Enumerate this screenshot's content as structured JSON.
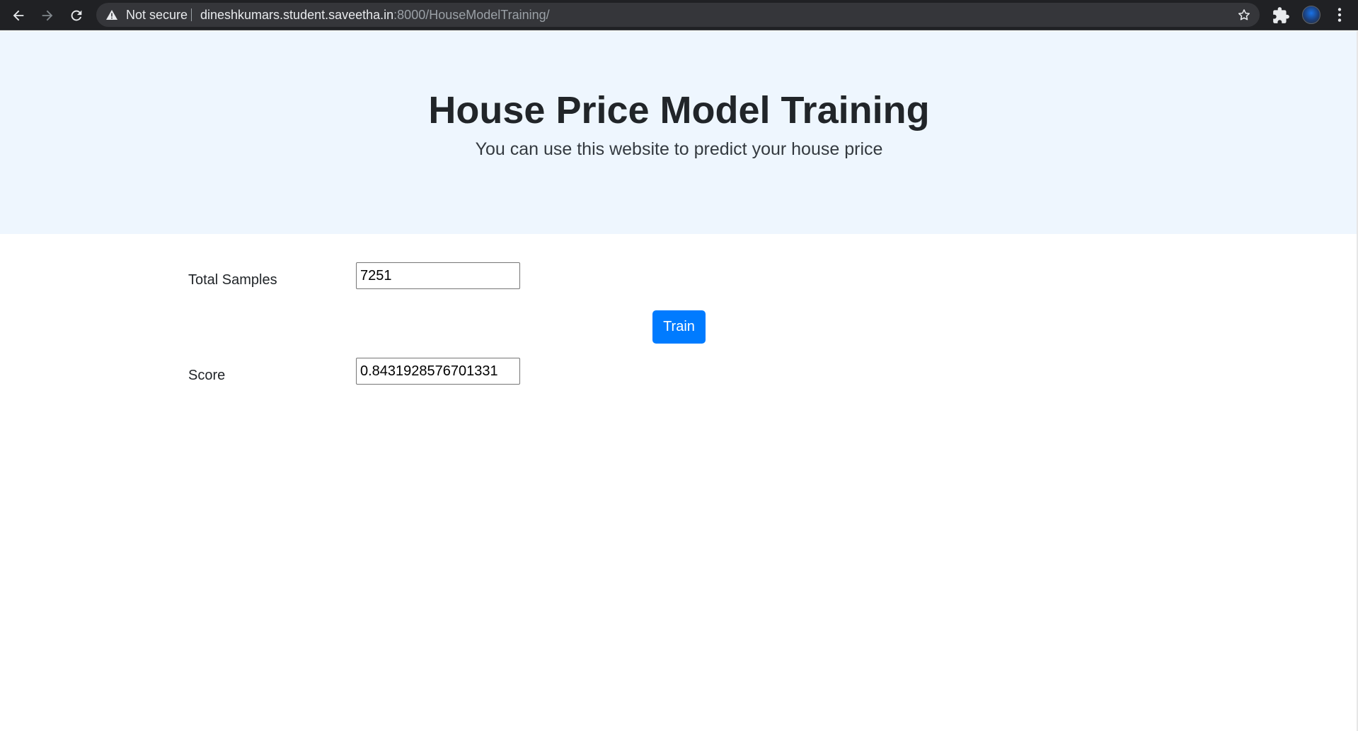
{
  "browser": {
    "security_label": "Not secure",
    "url_host": "dineshkumars.student.saveetha.in",
    "url_rest": ":8000/HouseModelTraining/"
  },
  "hero": {
    "title": "House Price Model Training",
    "subtitle": "You can use this website to predict your house price"
  },
  "form": {
    "total_samples_label": "Total Samples",
    "total_samples_value": "7251",
    "train_label": "Train",
    "score_label": "Score",
    "score_value": "0.8431928576701331"
  },
  "colors": {
    "hero_background": "#eef6fe",
    "button_primary": "#007bff",
    "browser_chrome": "#202124"
  }
}
